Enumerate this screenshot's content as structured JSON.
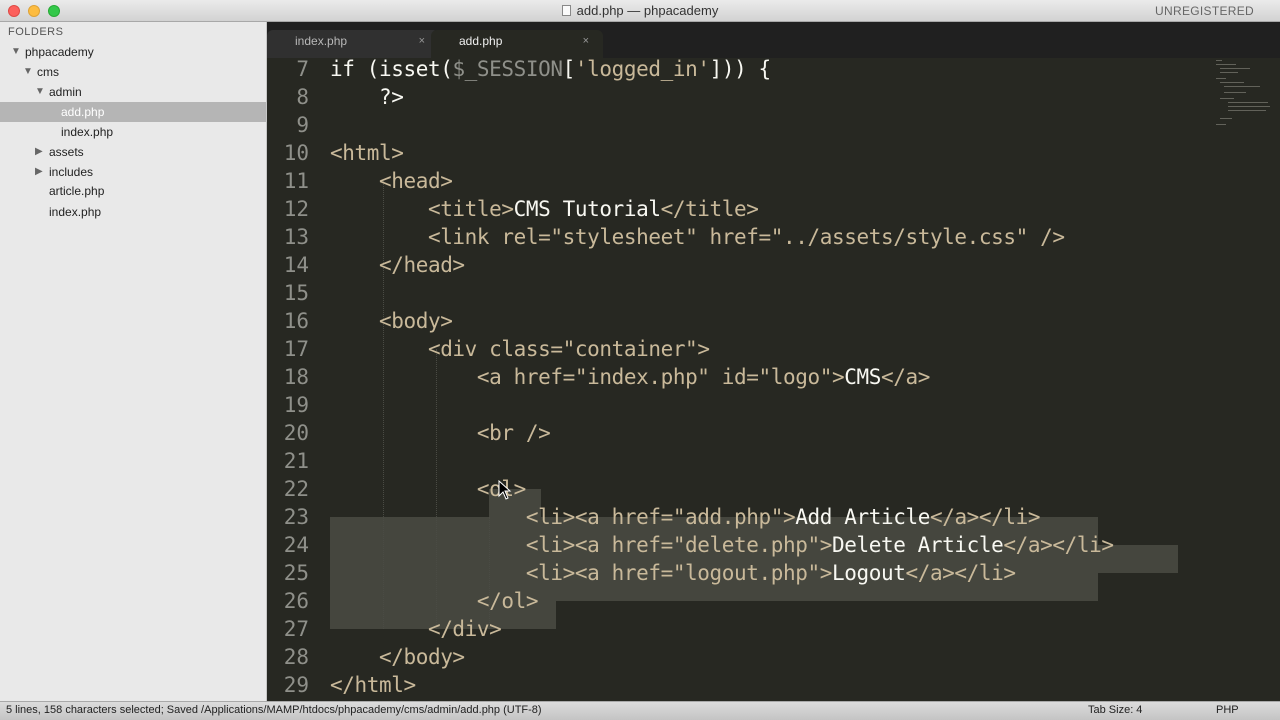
{
  "window": {
    "title": "add.php — phpacademy",
    "unregistered": "UNREGISTERED"
  },
  "sidebar": {
    "header": "FOLDERS",
    "items": [
      {
        "label": "phpacademy",
        "disclosure": "▼"
      },
      {
        "label": "cms",
        "disclosure": "▼"
      },
      {
        "label": "admin",
        "disclosure": "▼"
      },
      {
        "label": "add.php",
        "disclosure": ""
      },
      {
        "label": "index.php",
        "disclosure": ""
      },
      {
        "label": "assets",
        "disclosure": "▶"
      },
      {
        "label": "includes",
        "disclosure": "▶"
      },
      {
        "label": "article.php",
        "disclosure": ""
      },
      {
        "label": "index.php",
        "disclosure": ""
      }
    ],
    "selected_index": 3
  },
  "tabs": [
    {
      "label": "index.php",
      "close": "×",
      "active": false
    },
    {
      "label": "add.php",
      "close": "×",
      "active": true
    }
  ],
  "editor": {
    "line_numbers": [
      "7",
      "8",
      "9",
      "10",
      "11",
      "12",
      "13",
      "14",
      "15",
      "16",
      "17",
      "18",
      "19",
      "20",
      "21",
      "22",
      "23",
      "24",
      "25",
      "26",
      "27",
      "28",
      "29"
    ]
  },
  "status": {
    "message": "5 lines, 158 characters selected; Saved /Applications/MAMP/htdocs/phpacademy/cms/admin/add.php (UTF-8)",
    "tab_size": "Tab Size: 4",
    "syntax": "PHP"
  },
  "colors": {
    "editor_bg": "#272822",
    "selection": "#45463e",
    "tag": "#c9b99a",
    "text": "#f8f8f2"
  }
}
